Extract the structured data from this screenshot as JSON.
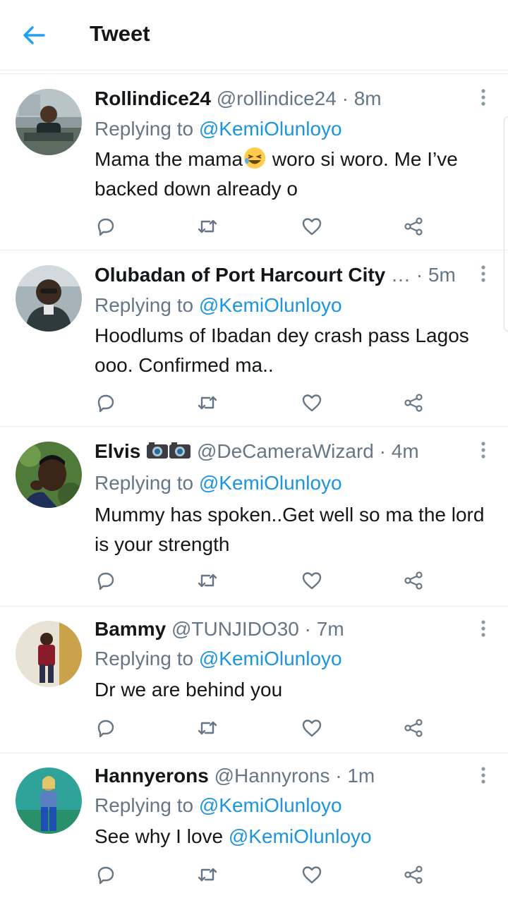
{
  "header": {
    "title": "Tweet"
  },
  "tweets": [
    {
      "name": "Rollindice24",
      "handle": "@rollindice24",
      "dot": "·",
      "time": "8m",
      "replying_label": "Replying to",
      "replying_to": "@KemiOlunloyo",
      "text_before": "Mama the mama",
      "text_after": " woro si woro. Me I’ve backed down already o"
    },
    {
      "name": "Olubadan of Port Harcourt City",
      "ellipsis": "…",
      "dot": "·",
      "time": "5m",
      "replying_label": "Replying to",
      "replying_to": "@KemiOlunloyo",
      "text": "Hoodlums of Ibadan dey crash pass Lagos ooo. Confirmed ma.."
    },
    {
      "name": "Elvis",
      "handle": "@DeCameraWizard",
      "dot": "·",
      "time": "4m",
      "replying_label": "Replying to",
      "replying_to": "@KemiOlunloyo",
      "text": "Mummy has spoken..Get well so ma the lord is your strength"
    },
    {
      "name": "Bammy",
      "handle": "@TUNJIDO30",
      "dot": "·",
      "time": "7m",
      "replying_label": "Replying to",
      "replying_to": "@KemiOlunloyo",
      "text": "Dr we are behind you"
    },
    {
      "name": "Hannyerons",
      "handle": "@Hannyrons",
      "dot": "·",
      "time": "1m",
      "replying_label": "Replying to",
      "replying_to": "@KemiOlunloyo",
      "text": "See why I love ",
      "text_mention": "@KemiOlunloyo"
    }
  ],
  "icons": {
    "back": "arrow-left-icon",
    "more": "more-vertical-icon",
    "reply": "reply-icon",
    "retweet": "retweet-icon",
    "like": "heart-icon",
    "share": "share-icon"
  },
  "colors": {
    "accent": "#1da1f2",
    "mention": "#1b95e0",
    "secondary": "#657786",
    "divider": "#e6ecf0"
  }
}
